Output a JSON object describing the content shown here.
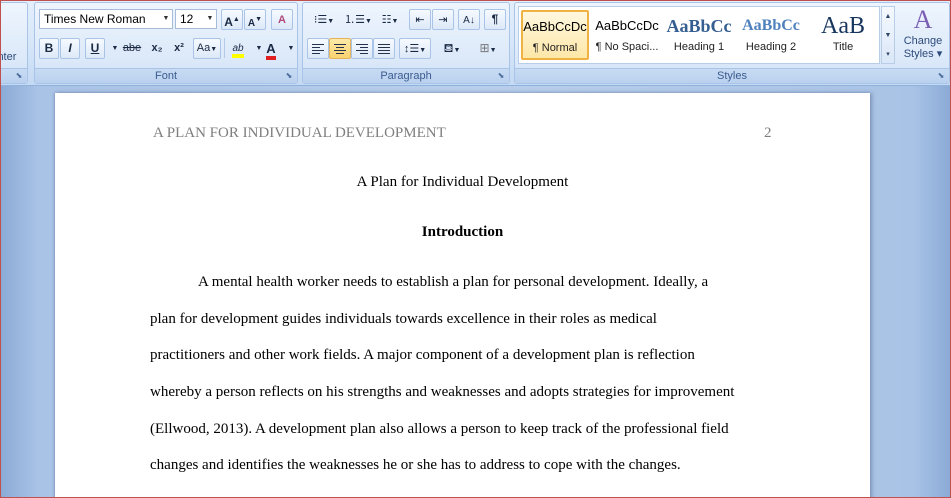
{
  "ribbon": {
    "clipboard": {
      "painter_label": "inter"
    },
    "font": {
      "family": "Times New Roman",
      "size": "12",
      "grow_label": "A",
      "shrink_label": "A",
      "clear_label": "A",
      "bold_label": "B",
      "italic_label": "I",
      "underline_label": "U",
      "strike_label": "abe",
      "subscript_label": "x₂",
      "superscript_label": "x²",
      "case_label": "Aa",
      "highlight_label": "ab",
      "color_label": "A",
      "group_label": "Font"
    },
    "paragraph": {
      "pilcrow_label": "¶",
      "group_label": "Paragraph"
    },
    "styles": {
      "items": [
        {
          "sample": "AaBbCcDc",
          "name": "¶ Normal"
        },
        {
          "sample": "AaBbCcDc",
          "name": "¶ No Spaci..."
        },
        {
          "sample": "AaBbCc",
          "name": "Heading 1"
        },
        {
          "sample": "AaBbCc",
          "name": "Heading 2"
        },
        {
          "sample": "AaB",
          "name": "Title"
        }
      ],
      "change_icon": "A",
      "change_label_1": "Change",
      "change_label_2": "Styles ▾",
      "group_label": "Styles"
    },
    "colors": {
      "highlight": "#ffff00",
      "font_color": "#e02020",
      "accent": "#f0b343"
    }
  },
  "document": {
    "header_text": "A PLAN FOR INDIVIDUAL DEVELOPMENT",
    "page_number": "2",
    "title": "A Plan for Individual Development",
    "heading": "Introduction",
    "body_lines": [
      "A mental health worker needs to establish  a plan for personal  development. Ideally, a",
      "plan for development guides individuals towards excellence in their roles as medical",
      "practitioners and other work fields. A major component  of a development plan is reflection",
      "whereby a person reflects on his strengths and weaknesses and adopts strategies  for improvement",
      "(Ellwood, 2013). A development plan also allows a person to keep track of the professional field",
      "changes and identifies the weaknesses he  or she has to address to cope with the changes."
    ]
  }
}
